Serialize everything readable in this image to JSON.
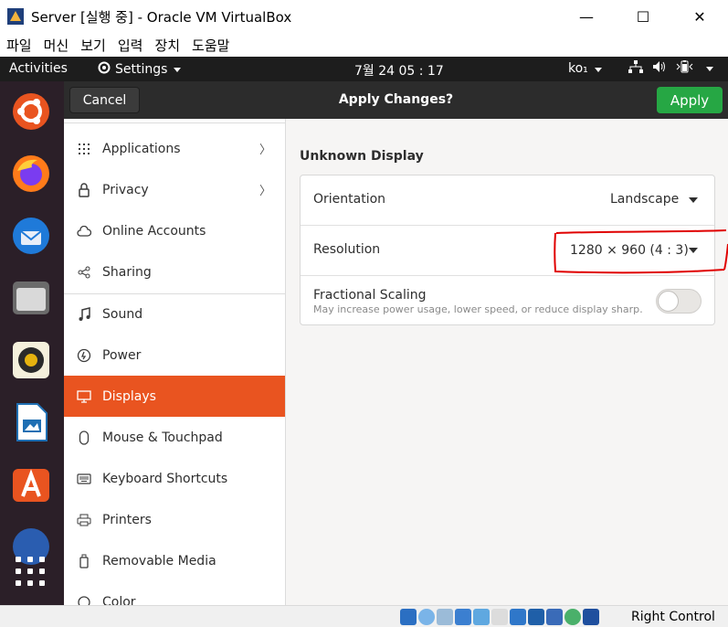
{
  "window": {
    "title": "Server [실행 중] - Oracle VM VirtualBox",
    "controls": {
      "minimize": "—",
      "maximize": "☐",
      "close": "✕"
    }
  },
  "menubar": [
    "파일",
    "머신",
    "보기",
    "입력",
    "장치",
    "도움말"
  ],
  "topbar": {
    "activities": "Activities",
    "app_menu": "Settings",
    "clock": "7월 24  05 : 17",
    "input_method": "ko₁"
  },
  "dock": {
    "items": [
      "ubuntu-icon",
      "firefox-icon",
      "thunderbird-icon",
      "files-icon",
      "rhythmbox-icon",
      "libreoffice-impress-icon",
      "software-center-icon",
      "help-icon"
    ]
  },
  "header": {
    "cancel_label": "Cancel",
    "title": "Apply Changes?",
    "apply_label": "Apply"
  },
  "sidebar": {
    "items": [
      {
        "label": "Applications",
        "icon": "grid-icon",
        "chevron": "〉"
      },
      {
        "label": "Privacy",
        "icon": "lock-icon",
        "chevron": "〉"
      },
      {
        "label": "Online Accounts",
        "icon": "cloud-icon"
      },
      {
        "label": "Sharing",
        "icon": "share-icon"
      },
      {
        "label": "Sound",
        "icon": "music-icon"
      },
      {
        "label": "Power",
        "icon": "power-icon"
      },
      {
        "label": "Displays",
        "icon": "display-icon",
        "active": true
      },
      {
        "label": "Mouse & Touchpad",
        "icon": "mouse-icon"
      },
      {
        "label": "Keyboard Shortcuts",
        "icon": "keyboard-icon"
      },
      {
        "label": "Printers",
        "icon": "printer-icon"
      },
      {
        "label": "Removable Media",
        "icon": "usb-icon"
      },
      {
        "label": "Color",
        "icon": "color-icon"
      }
    ]
  },
  "display": {
    "name": "Unknown Display",
    "orientation_label": "Orientation",
    "orientation_value": "Landscape",
    "resolution_label": "Resolution",
    "resolution_value": "1280 × 960 (4 : 3)",
    "scaling_label": "Fractional Scaling",
    "scaling_sub": "May increase power usage, lower speed, or reduce display sharp…",
    "scaling_enabled": false
  },
  "statusbar": {
    "host_key": "Right Control"
  },
  "colors": {
    "accent": "#e95420",
    "apply": "#26a744",
    "annotation": "#e00000"
  }
}
